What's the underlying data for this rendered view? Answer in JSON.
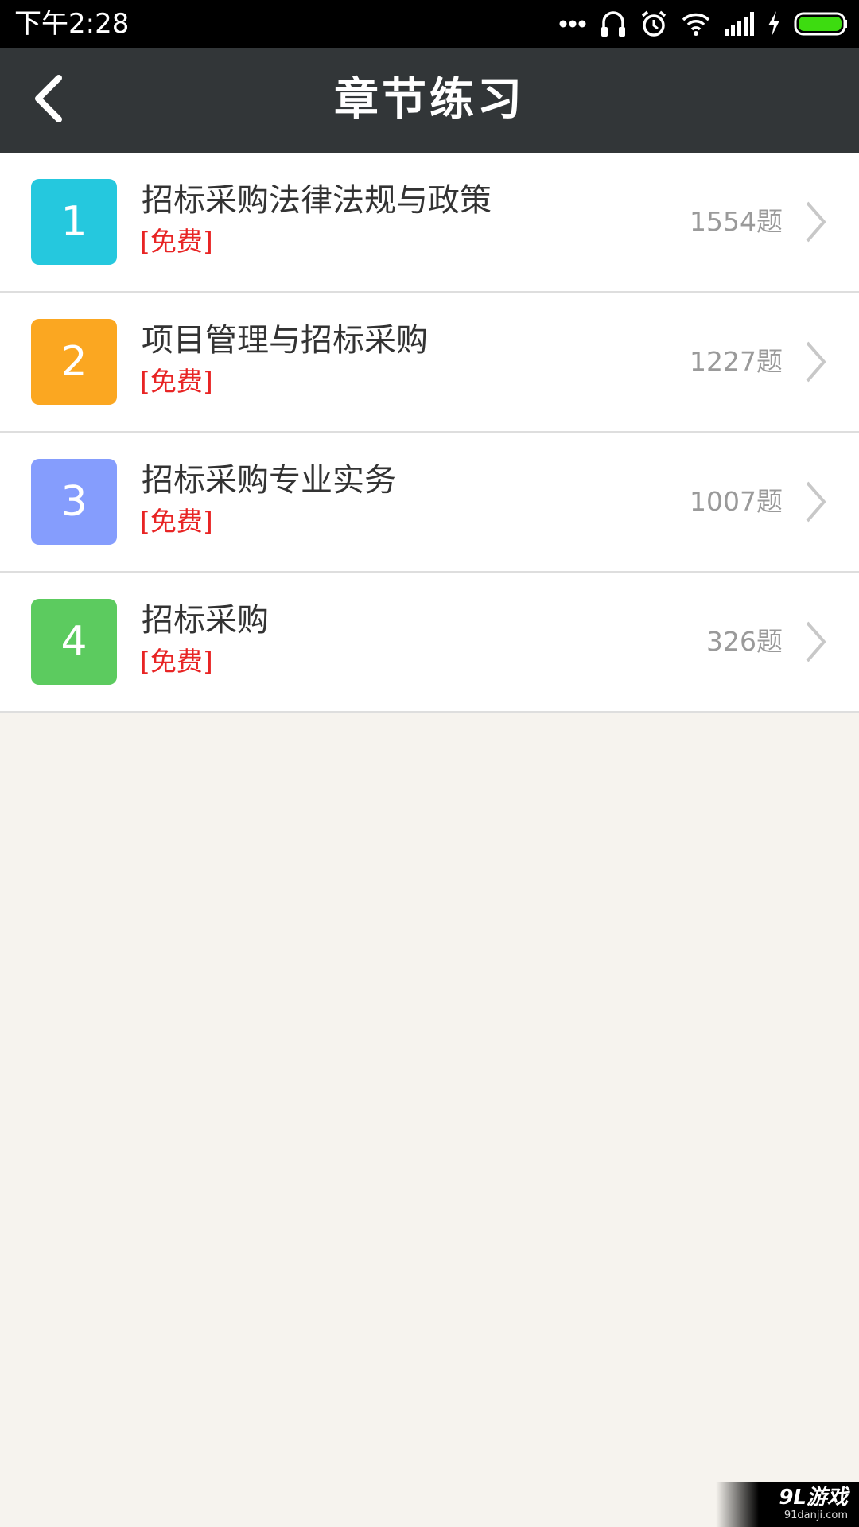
{
  "status_bar": {
    "time": "下午2:28",
    "icons": [
      "more-dots-icon",
      "headset-icon",
      "alarm-icon",
      "wifi-icon",
      "signal-icon",
      "charging-icon",
      "battery-icon"
    ]
  },
  "header": {
    "title": "章节练习",
    "back_icon": "back-arrow-icon"
  },
  "chapters": [
    {
      "number": "1",
      "title": "招标采购法律法规与政策",
      "tag": "[免费]",
      "count": "1554题",
      "color": "#25c8de"
    },
    {
      "number": "2",
      "title": "项目管理与招标采购",
      "tag": "[免费]",
      "count": "1227题",
      "color": "#fba721"
    },
    {
      "number": "3",
      "title": "招标采购专业实务",
      "tag": "[免费]",
      "count": "1007题",
      "color": "#859dfd"
    },
    {
      "number": "4",
      "title": "招标采购",
      "tag": "[免费]",
      "count": "326题",
      "color": "#5ccb5f"
    }
  ],
  "watermark": {
    "logo": "9L游戏",
    "url": "91danji.com"
  },
  "colors": {
    "status_bar": "#000000",
    "title_bar": "#323638",
    "background": "#f6f3ee",
    "free_tag": "#e82424",
    "count_text": "#9a9a9a"
  }
}
